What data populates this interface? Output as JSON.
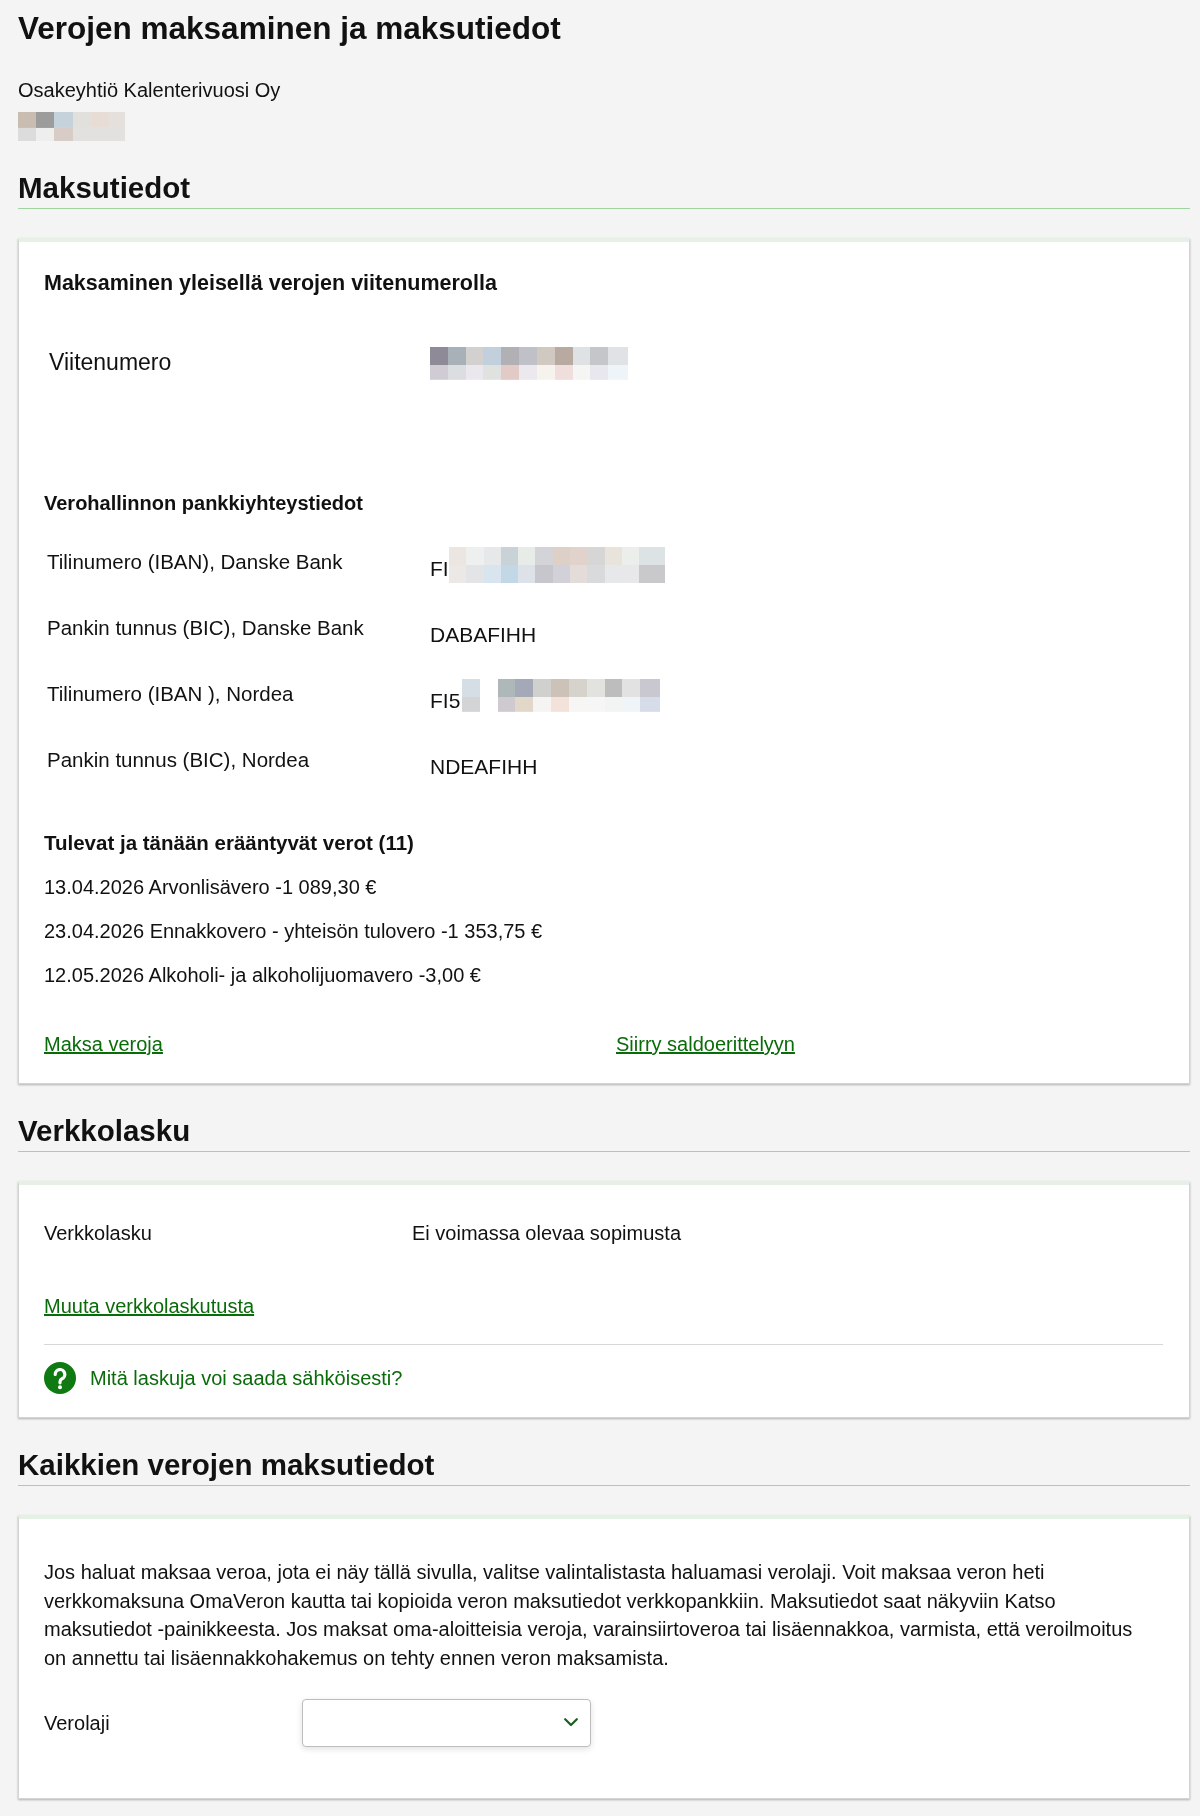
{
  "page": {
    "title": "Verojen maksaminen ja maksutiedot",
    "organization": {
      "name": "Osakeyhtiö Kalenterivuosi Oy",
      "id_redacted": true
    }
  },
  "payment_details": {
    "heading": "Maksutiedot",
    "reference_title": "Maksaminen yleisellä verojen viitenumerolla",
    "reference": {
      "label": "Viitenumero",
      "redacted": true
    },
    "bank_title": "Verohallinnon pankkiyhteystiedot",
    "bank_rows": [
      {
        "label": "Tilinumero (IBAN), Danske Bank",
        "value": "FI",
        "redacted": true
      },
      {
        "label": "Pankin tunnus (BIC), Danske Bank",
        "value": "DABAFIHH",
        "redacted": false
      },
      {
        "label": "Tilinumero (IBAN ), Nordea",
        "value": "FI5",
        "redacted": true
      },
      {
        "label": "Pankin tunnus (BIC), Nordea",
        "value": "NDEAFIHH",
        "redacted": false
      }
    ],
    "upcoming_title": "Tulevat ja tänään erääntyvät verot (11)",
    "upcoming": [
      "13.04.2026 Arvonlisävero -1 089,30 €",
      "23.04.2026 Ennakkovero - yhteisön tulovero -1 353,75 €",
      "12.05.2026 Alkoholi- ja alkoholijuomavero -3,00 €"
    ],
    "links": [
      {
        "label": "Maksa veroja"
      },
      {
        "label": "Siirry saldoerittelyyn"
      }
    ]
  },
  "e_invoice": {
    "heading": "Verkkolasku",
    "label": "Verkkolasku",
    "value": "Ei voimassa olevaa sopimusta",
    "link": "Muuta verkkolaskutusta",
    "help": "Mitä laskuja voi saada sähköisesti?"
  },
  "all_taxes": {
    "heading": "Kaikkien verojen maksutiedot",
    "text": "Jos haluat maksaa veroa, jota ei näy tällä sivulla, valitse valintalistasta haluamasi verolaji. Voit maksaa veron heti verkkomaksuna OmaVeron kautta tai kopioida veron maksutiedot verkkopankkiin. Maksutiedot saat näkyviin Katso maksutiedot -painikkeesta. Jos maksat oma-aloitteisia veroja, varainsiirtoveroa tai lisäennakkoa, varmista, että veroilmoitus on annettu tai lisäennakkohakemus on tehty ennen veron maksamista.",
    "field_label": "Verolaji"
  }
}
